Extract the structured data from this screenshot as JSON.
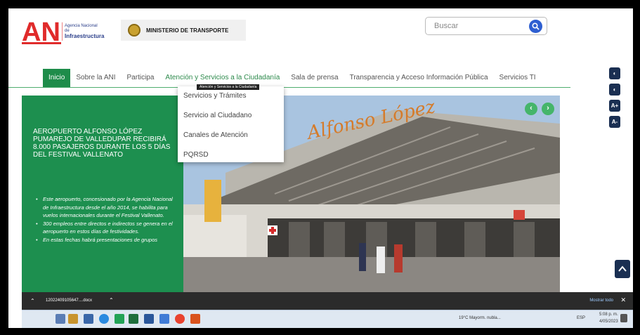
{
  "header": {
    "ani_logo": "ANI",
    "ani_name_line1": "Agencia Nacional de",
    "ani_name_line2": "Infraestructura",
    "ministry": "MINISTERIO DE TRANSPORTE",
    "search_placeholder": "Buscar"
  },
  "nav": {
    "items": [
      "Inicio",
      "Sobre la ANI",
      "Participa",
      "Atención y Servicios a la Ciudadanía",
      "Sala de prensa",
      "Transparencia y Acceso Información Pública",
      "Servicios TI"
    ],
    "tooltip": "Atención y Servicios a la Ciudadanía"
  },
  "dropdown": {
    "items": [
      "Servicios y Trámites",
      "Servicio al Ciudadano",
      "Canales de Atención",
      "PQRSD"
    ]
  },
  "accessibility": [
    "◐",
    "◐",
    "A+",
    "A-"
  ],
  "hero": {
    "title": "AEROPUERTO ALFONSO LÓPEZ PUMAREJO DE VALLEDUPAR RECIBIRÁ 8.000 PASAJEROS DURANTE LOS 5 DÍAS DEL FESTIVAL VALLENATO",
    "bullets": [
      "Este aeropuerto, concesionado por la Agencia Nacional de Infraestructura desde el año 2014, se habilita para vuelos internacionales durante el Festival Vallenato.",
      "300 empleos entre directos e indirectos se genera en el aeropuerto en estos días de festividades.",
      "En estas fechas habrá presentaciones de grupos"
    ],
    "photo_sign": "Alfonso López",
    "prev": "‹",
    "next": "›"
  },
  "download_bar": {
    "file": "12022409105647....docx",
    "show_all": "Mostrar todo",
    "close": "✕"
  },
  "taskbar": {
    "weather": "19°C Mayorm. nubla...",
    "lang": "ESP",
    "time": "5:08 p. m.",
    "date": "4/05/2023"
  },
  "colors": {
    "green": "#1d8f4f",
    "navy": "#1a2f52",
    "accent_red": "#d62c2c"
  }
}
